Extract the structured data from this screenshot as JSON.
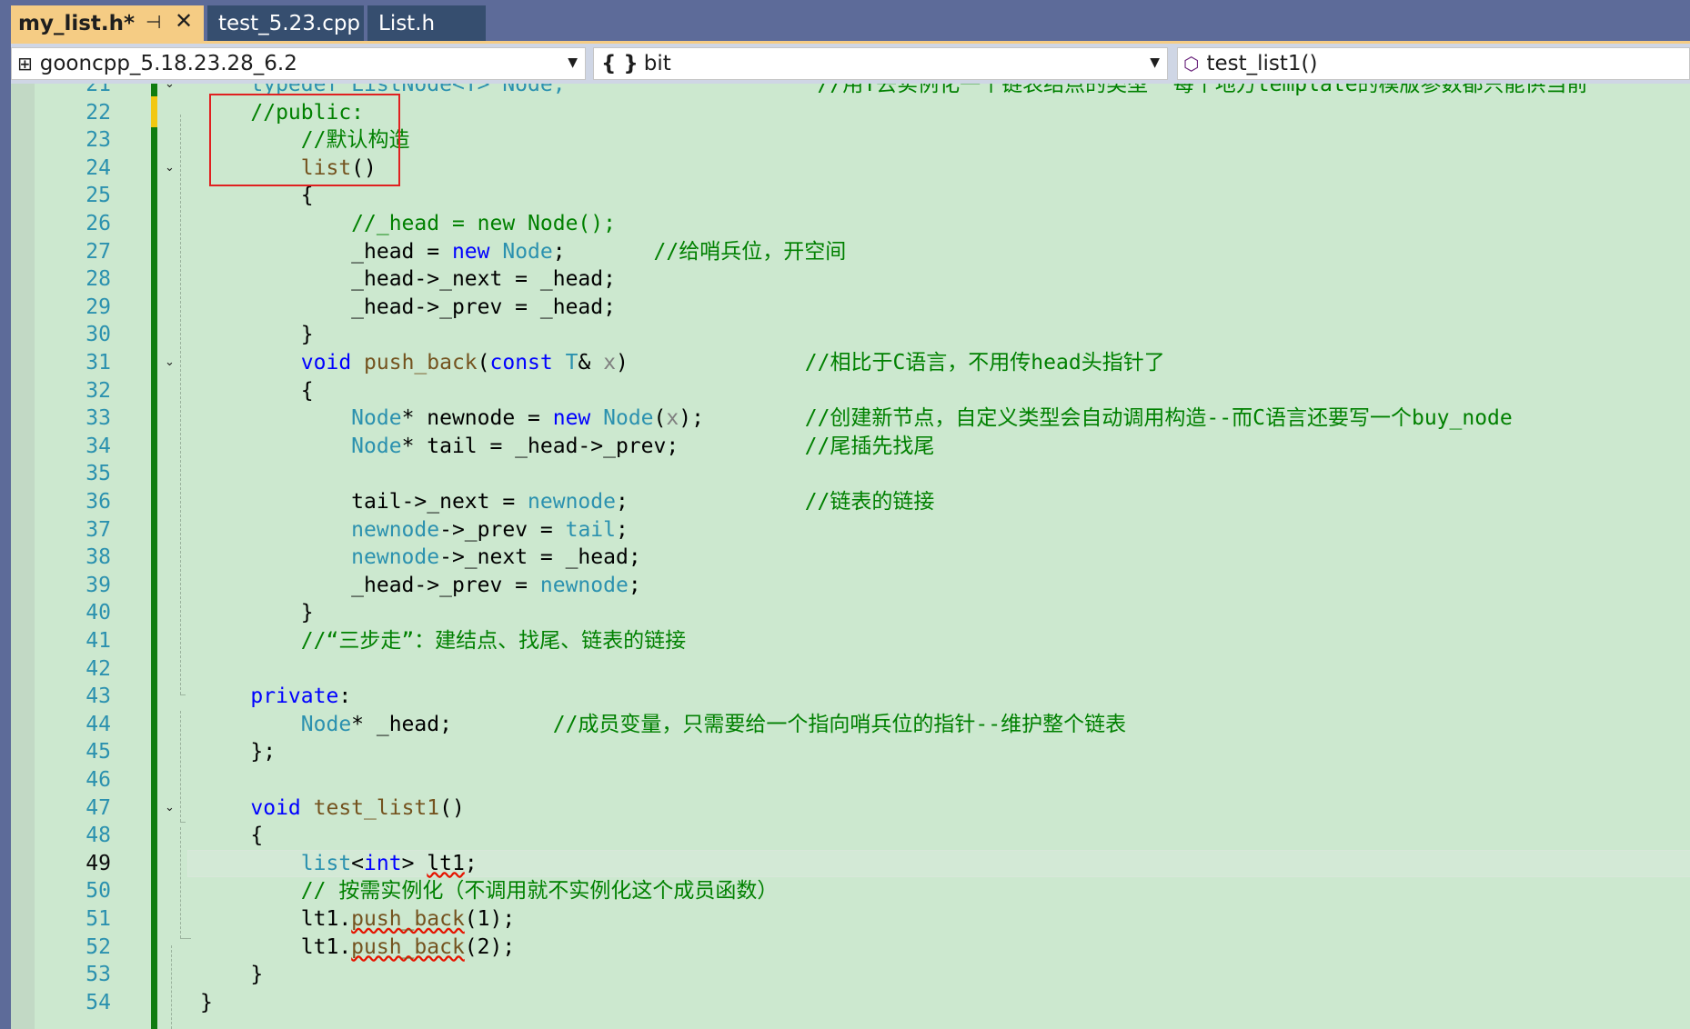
{
  "tabs": [
    {
      "label": "my_list.h*",
      "active": true,
      "pin_icon": "pin-icon",
      "close_icon": "close-icon"
    },
    {
      "label": "test_5.23.cpp",
      "active": false
    },
    {
      "label": "List.h",
      "active": false
    }
  ],
  "nav": {
    "project": "gooncpp_5.18.23.28_6.2",
    "scope": "bit",
    "member": "test_list1()"
  },
  "editor": {
    "current_line": 49,
    "lines": [
      {
        "n": 21,
        "fold": "collapse",
        "segs": [
          [
            "ty",
            "    typedef ListNode<T> Node;"
          ],
          [
            "cm",
            "                    //用T去实例化一个链表结点的类型  每个地方template的模版参数都只能供当前"
          ]
        ]
      },
      {
        "n": 22,
        "segs": [
          [
            "cm",
            "    //public:"
          ]
        ]
      },
      {
        "n": 23,
        "segs": [
          [
            "cm",
            "        //默认构造"
          ]
        ]
      },
      {
        "n": 24,
        "fold": "collapse",
        "segs": [
          [
            "fn",
            "        list"
          ],
          [
            "",
            "()"
          ]
        ]
      },
      {
        "n": 25,
        "segs": [
          [
            "",
            "        {"
          ]
        ]
      },
      {
        "n": 26,
        "segs": [
          [
            "cm",
            "            //_head = new Node();"
          ]
        ]
      },
      {
        "n": 27,
        "segs": [
          [
            "",
            "            _head = "
          ],
          [
            "kw",
            "new"
          ],
          [
            "",
            " "
          ],
          [
            "ty",
            "Node"
          ],
          [
            "",
            ";       "
          ],
          [
            "cm",
            "//给哨兵位，开空间"
          ]
        ]
      },
      {
        "n": 28,
        "segs": [
          [
            "",
            "            _head->_next = _head;"
          ]
        ]
      },
      {
        "n": 29,
        "segs": [
          [
            "",
            "            _head->_prev = _head;"
          ]
        ]
      },
      {
        "n": 30,
        "segs": [
          [
            "",
            "        }"
          ]
        ]
      },
      {
        "n": 31,
        "fold": "collapse",
        "segs": [
          [
            "kw",
            "        void"
          ],
          [
            "",
            " "
          ],
          [
            "fn",
            "push_back"
          ],
          [
            "",
            "("
          ],
          [
            "kw",
            "const"
          ],
          [
            "",
            " "
          ],
          [
            "ty",
            "T"
          ],
          [
            "",
            "& "
          ],
          [
            "pa",
            "x"
          ],
          [
            "",
            ")              "
          ],
          [
            "cm",
            "//相比于C语言，不用传head头指针了"
          ]
        ]
      },
      {
        "n": 32,
        "segs": [
          [
            "",
            "        {"
          ]
        ]
      },
      {
        "n": 33,
        "segs": [
          [
            "ty",
            "            Node"
          ],
          [
            "",
            "* newnode = "
          ],
          [
            "kw",
            "new"
          ],
          [
            "",
            " "
          ],
          [
            "ty",
            "Node"
          ],
          [
            "",
            "("
          ],
          [
            "pa",
            "x"
          ],
          [
            "",
            ");        "
          ],
          [
            "cm",
            "//创建新节点，自定义类型会自动调用构造--而C语言还要写一个buy_node"
          ]
        ]
      },
      {
        "n": 34,
        "segs": [
          [
            "ty",
            "            Node"
          ],
          [
            "",
            "* tail = _head->_prev;          "
          ],
          [
            "cm",
            "//尾插先找尾"
          ]
        ]
      },
      {
        "n": 35,
        "segs": [
          [
            "",
            ""
          ]
        ]
      },
      {
        "n": 36,
        "segs": [
          [
            "",
            "            tail->_next = "
          ],
          [
            "ty",
            "newnode"
          ],
          [
            "",
            ";              "
          ],
          [
            "cm",
            "//链表的链接"
          ]
        ]
      },
      {
        "n": 37,
        "segs": [
          [
            "ty",
            "            newnode"
          ],
          [
            "",
            "->_prev = "
          ],
          [
            "ty",
            "tail"
          ],
          [
            "",
            ";"
          ]
        ]
      },
      {
        "n": 38,
        "segs": [
          [
            "ty",
            "            newnode"
          ],
          [
            "",
            "->_next = _head;"
          ]
        ]
      },
      {
        "n": 39,
        "segs": [
          [
            "",
            "            _head->_prev = "
          ],
          [
            "ty",
            "newnode"
          ],
          [
            "",
            ";"
          ]
        ]
      },
      {
        "n": 40,
        "segs": [
          [
            "",
            "        }"
          ]
        ]
      },
      {
        "n": 41,
        "segs": [
          [
            "cm",
            "        //“三步走”：建结点、找尾、链表的链接"
          ]
        ]
      },
      {
        "n": 42,
        "segs": [
          [
            "",
            ""
          ]
        ]
      },
      {
        "n": 43,
        "segs": [
          [
            "kw",
            "    private"
          ],
          [
            "",
            ":"
          ]
        ]
      },
      {
        "n": 44,
        "segs": [
          [
            "ty",
            "        Node"
          ],
          [
            "",
            "* _head;        "
          ],
          [
            "cm",
            "//成员变量，只需要给一个指向哨兵位的指针--维护整个链表"
          ]
        ]
      },
      {
        "n": 45,
        "segs": [
          [
            "",
            "    };"
          ]
        ]
      },
      {
        "n": 46,
        "segs": [
          [
            "",
            ""
          ]
        ]
      },
      {
        "n": 47,
        "fold": "collapse",
        "segs": [
          [
            "kw",
            "    void"
          ],
          [
            "",
            " "
          ],
          [
            "fn",
            "test_list1"
          ],
          [
            "",
            "()"
          ]
        ]
      },
      {
        "n": 48,
        "segs": [
          [
            "",
            "    {"
          ]
        ]
      },
      {
        "n": 49,
        "segs": [
          [
            "ty",
            "        list"
          ],
          [
            "",
            "<"
          ],
          [
            "kw",
            "int"
          ],
          [
            "",
            "> "
          ],
          [
            "er",
            "lt1"
          ],
          [
            "",
            ";"
          ]
        ]
      },
      {
        "n": 50,
        "segs": [
          [
            "cm",
            "        // 按需实例化（不调用就不实例化这个成员函数）"
          ]
        ]
      },
      {
        "n": 51,
        "segs": [
          [
            "",
            "        lt1."
          ],
          [
            "erfn",
            "push_back"
          ],
          [
            "",
            "(1);"
          ]
        ]
      },
      {
        "n": 52,
        "segs": [
          [
            "",
            "        lt1."
          ],
          [
            "erfn",
            "push_back"
          ],
          [
            "",
            "(2);"
          ]
        ]
      },
      {
        "n": 53,
        "segs": [
          [
            "",
            "    }"
          ]
        ]
      },
      {
        "n": 54,
        "segs": [
          [
            "",
            "}"
          ]
        ]
      }
    ]
  },
  "colors": {
    "editor_bg": "#cce8cf",
    "tab_active_bg": "#f5cc84",
    "tab_inactive_bg": "#364e6f",
    "change_bar": "#107c10",
    "highlight_rect": "#e02020"
  }
}
